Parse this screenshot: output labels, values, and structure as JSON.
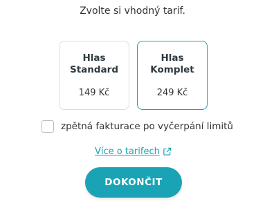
{
  "prompt": "Zvolte si vhodný tarif.",
  "tariffs": [
    {
      "name_line1": "Hlas",
      "name_line2": "Standard",
      "price": "149 Kč",
      "selected": false
    },
    {
      "name_line1": "Hlas Komplet",
      "name_line2": "",
      "price": "249 Kč",
      "selected": true
    }
  ],
  "option": {
    "label": "zpětná fakturace po vyčerpání limitů",
    "checked": false
  },
  "more_link": {
    "label": "Více o tarifech",
    "icon": "external-link-icon"
  },
  "finish_button": {
    "label": "DOKONČIT"
  },
  "colors": {
    "accent": "#1aa3b5",
    "border": "#d9dee0",
    "text": "#2f3a40"
  }
}
